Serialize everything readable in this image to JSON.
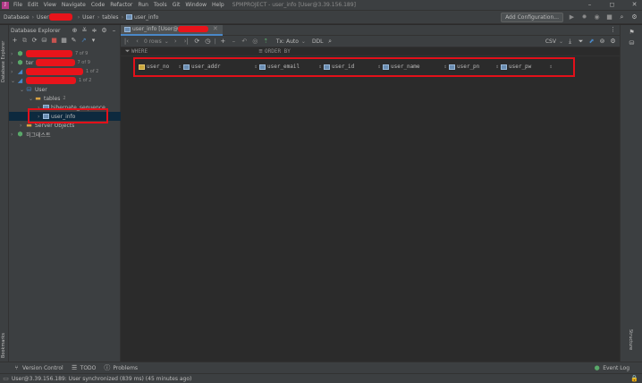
{
  "menubar": {
    "items": [
      "File",
      "Edit",
      "View",
      "Navigate",
      "Code",
      "Refactor",
      "Run",
      "Tools",
      "Git",
      "Window",
      "Help"
    ],
    "title": "SPMPROJECT - user_info [User@3.39.156.189]"
  },
  "navbar": {
    "crumbs": [
      "Database",
      "User",
      "User",
      "tables",
      "user_info"
    ],
    "add_config": "Add Configuration..."
  },
  "db_panel": {
    "title": "Database Explorer",
    "side_tab": "Database Explorer",
    "tree": [
      {
        "label": "",
        "suffix": "7 of 9",
        "level": 0,
        "icon": "mysql"
      },
      {
        "label": "ter",
        "suffix": "7 of 9",
        "level": 0,
        "icon": "mysql"
      },
      {
        "label": "",
        "suffix": "1 of 2",
        "level": 0,
        "icon": "mysql"
      },
      {
        "label": "",
        "suffix": "1 of 2",
        "level": 0,
        "icon": "mysql"
      },
      {
        "label": "User",
        "suffix": "",
        "level": 1,
        "icon": "schema"
      },
      {
        "label": "tables",
        "suffix": "2",
        "level": 2,
        "icon": "folder"
      },
      {
        "label": "hibernate_sequence",
        "suffix": "",
        "level": 3,
        "icon": "table"
      },
      {
        "label": "user_info",
        "suffix": "",
        "level": 3,
        "icon": "table"
      },
      {
        "label": "Server Objects",
        "suffix": "",
        "level": 1,
        "icon": "folder"
      },
      {
        "label": "히그테스트",
        "suffix": "",
        "level": 0,
        "icon": "mysql"
      }
    ]
  },
  "editor": {
    "tab_label": "user_info [User@",
    "toolbar": {
      "rows_label": "0 rows",
      "tx_label": "Tx: Auto",
      "ddl_label": "DDL",
      "export_label": "CSV"
    },
    "where_label": "WHERE",
    "orderby_label": "ORDER BY",
    "columns": [
      "user_no",
      "user_addr",
      "user_email",
      "user_id",
      "user_name",
      "user_pn",
      "user_pw"
    ]
  },
  "bottom": {
    "tabs": [
      "Version Control",
      "TODO",
      "Problems"
    ],
    "event_log": "Event Log",
    "bookmarks": "Bookmarks",
    "structure": "Structure"
  },
  "status": {
    "text": "User@3.39.156.189: User synchronized (839 ms) (45 minutes ago)"
  },
  "colors": {
    "highlight": "#e3101a",
    "redaction": "#e8141b",
    "selection": "#0d293e"
  }
}
